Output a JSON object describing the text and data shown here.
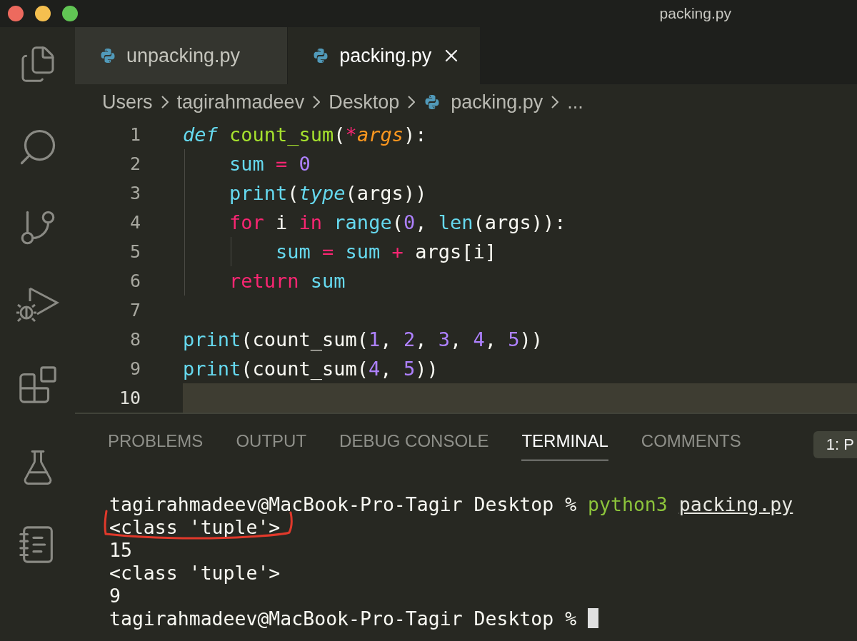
{
  "window": {
    "title": "packing.py"
  },
  "tabs": [
    {
      "label": "unpacking.py",
      "selected": false
    },
    {
      "label": "packing.py",
      "selected": true
    }
  ],
  "breadcrumbs": [
    {
      "label": "Users",
      "kind": "folder"
    },
    {
      "label": "tagirahmadeev",
      "kind": "folder"
    },
    {
      "label": "Desktop",
      "kind": "folder"
    },
    {
      "label": "packing.py",
      "kind": "file"
    },
    {
      "label": "...",
      "kind": "more"
    }
  ],
  "editor": {
    "lines": [
      {
        "number": "1",
        "current": false,
        "tokens": [
          {
            "text": "def ",
            "kind": "storage"
          },
          {
            "text": "count_sum",
            "kind": "function"
          },
          {
            "text": "(",
            "kind": "plain"
          },
          {
            "text": "*",
            "kind": "keyword"
          },
          {
            "text": "args",
            "kind": "param"
          },
          {
            "text": "):",
            "kind": "plain"
          }
        ]
      },
      {
        "number": "2",
        "current": false,
        "tokens": [
          {
            "text": "    sum ",
            "kind": "builtin"
          },
          {
            "text": "= ",
            "kind": "keyword"
          },
          {
            "text": "0",
            "kind": "number"
          }
        ]
      },
      {
        "number": "3",
        "current": false,
        "tokens": [
          {
            "text": "    print",
            "kind": "builtin"
          },
          {
            "text": "(",
            "kind": "plain"
          },
          {
            "text": "type",
            "kind": "type"
          },
          {
            "text": "(args))",
            "kind": "plain"
          }
        ]
      },
      {
        "number": "4",
        "current": false,
        "tokens": [
          {
            "text": "    for",
            "kind": "keyword"
          },
          {
            "text": " i ",
            "kind": "plain"
          },
          {
            "text": "in ",
            "kind": "keyword"
          },
          {
            "text": "range",
            "kind": "builtin"
          },
          {
            "text": "(",
            "kind": "plain"
          },
          {
            "text": "0",
            "kind": "number"
          },
          {
            "text": ", ",
            "kind": "plain"
          },
          {
            "text": "len",
            "kind": "builtin"
          },
          {
            "text": "(args)):",
            "kind": "plain"
          }
        ]
      },
      {
        "number": "5",
        "current": false,
        "tokens": [
          {
            "text": "        sum ",
            "kind": "builtin"
          },
          {
            "text": "= ",
            "kind": "keyword"
          },
          {
            "text": "sum ",
            "kind": "builtin"
          },
          {
            "text": "+",
            "kind": "keyword"
          },
          {
            "text": " args[i]",
            "kind": "plain"
          }
        ]
      },
      {
        "number": "6",
        "current": false,
        "tokens": [
          {
            "text": "    return ",
            "kind": "keyword"
          },
          {
            "text": "sum",
            "kind": "builtin"
          }
        ]
      },
      {
        "number": "7",
        "current": false
      },
      {
        "number": "8",
        "current": false,
        "tokens": [
          {
            "text": "print",
            "kind": "builtin"
          },
          {
            "text": "(count_sum(",
            "kind": "plain"
          },
          {
            "text": "1",
            "kind": "number"
          },
          {
            "text": ", ",
            "kind": "plain"
          },
          {
            "text": "2",
            "kind": "number"
          },
          {
            "text": ", ",
            "kind": "plain"
          },
          {
            "text": "3",
            "kind": "number"
          },
          {
            "text": ", ",
            "kind": "plain"
          },
          {
            "text": "4",
            "kind": "number"
          },
          {
            "text": ", ",
            "kind": "plain"
          },
          {
            "text": "5",
            "kind": "number"
          },
          {
            "text": "))",
            "kind": "plain"
          }
        ]
      },
      {
        "number": "9",
        "current": false,
        "tokens": [
          {
            "text": "print",
            "kind": "builtin"
          },
          {
            "text": "(count_sum(",
            "kind": "plain"
          },
          {
            "text": "4",
            "kind": "number"
          },
          {
            "text": ", ",
            "kind": "plain"
          },
          {
            "text": "5",
            "kind": "number"
          },
          {
            "text": "))",
            "kind": "plain"
          }
        ]
      },
      {
        "number": "10",
        "current": true
      }
    ]
  },
  "panel": {
    "tabs": [
      {
        "label": "PROBLEMS",
        "selected": false
      },
      {
        "label": "OUTPUT",
        "selected": false
      },
      {
        "label": "DEBUG CONSOLE",
        "selected": false
      },
      {
        "label": "TERMINAL",
        "selected": true
      },
      {
        "label": "COMMENTS",
        "selected": false
      }
    ],
    "terminal_selector": "1: P",
    "terminal": [
      {
        "annotated": false,
        "cursor": false,
        "tokens": [
          {
            "text": "tagirahmadeev@MacBook-Pro-Tagir Desktop % ",
            "kind": "plain"
          },
          {
            "text": "python3 ",
            "kind": "command"
          },
          {
            "text": "packing.py",
            "kind": "link"
          }
        ]
      },
      {
        "annotated": true,
        "cursor": false,
        "tokens": [
          {
            "text": "<class 'tuple'>",
            "kind": "plain"
          }
        ]
      },
      {
        "annotated": false,
        "cursor": false,
        "tokens": [
          {
            "text": "15",
            "kind": "plain"
          }
        ]
      },
      {
        "annotated": false,
        "cursor": false,
        "tokens": [
          {
            "text": "<class 'tuple'>",
            "kind": "plain"
          }
        ]
      },
      {
        "annotated": false,
        "cursor": false,
        "tokens": [
          {
            "text": "9",
            "kind": "plain"
          }
        ]
      },
      {
        "annotated": false,
        "cursor": true,
        "tokens": [
          {
            "text": "tagirahmadeev@MacBook-Pro-Tagir Desktop % ",
            "kind": "plain"
          }
        ]
      }
    ]
  }
}
